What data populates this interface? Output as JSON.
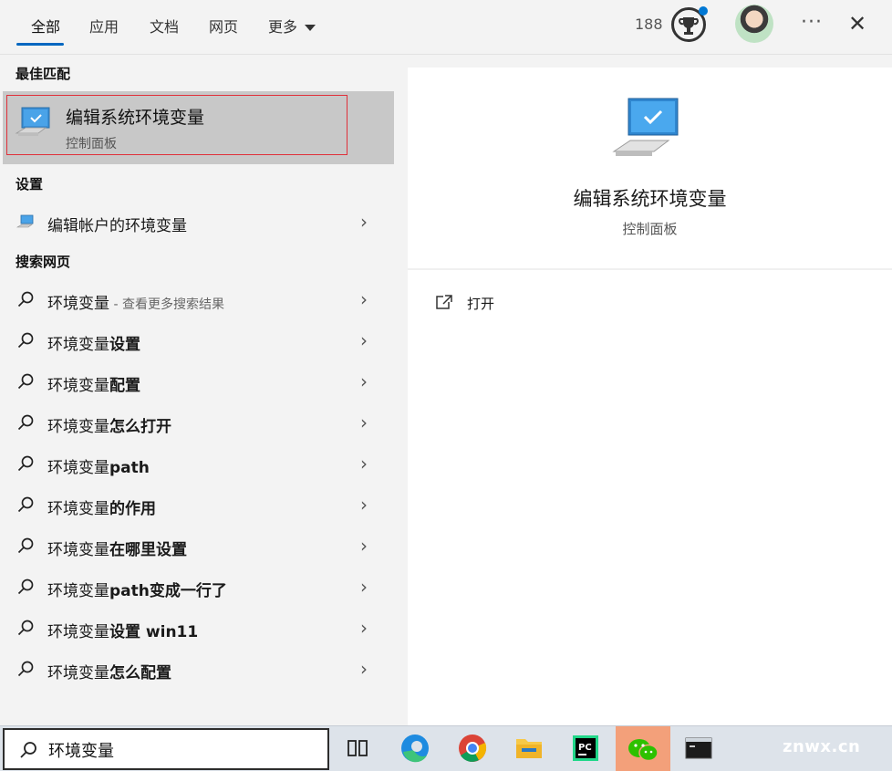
{
  "header": {
    "tabs": [
      {
        "label": "全部"
      },
      {
        "label": "应用"
      },
      {
        "label": "文档"
      },
      {
        "label": "网页"
      },
      {
        "label": "更多"
      }
    ],
    "points": "188",
    "more_label": "···",
    "close_label": "✕"
  },
  "left": {
    "best_match_title": "最佳匹配",
    "best_match": {
      "title": "编辑系统环境变量",
      "subtitle": "控制面板"
    },
    "settings_title": "设置",
    "settings_item": "编辑帐户的环境变量",
    "web_title": "搜索网页",
    "web_items": [
      {
        "normal": "环境变量",
        "bold": "",
        "hint": " - 查看更多搜索结果"
      },
      {
        "normal": "环境变量",
        "bold": "设置",
        "hint": ""
      },
      {
        "normal": "环境变量",
        "bold": "配置",
        "hint": ""
      },
      {
        "normal": "环境变量",
        "bold": "怎么打开",
        "hint": ""
      },
      {
        "normal": "环境变量",
        "bold": "path",
        "hint": ""
      },
      {
        "normal": "环境变量",
        "bold": "的作用",
        "hint": ""
      },
      {
        "normal": "环境变量",
        "bold": "在哪里设置",
        "hint": ""
      },
      {
        "normal": "环境变量",
        "bold": "path变成一行了",
        "hint": ""
      },
      {
        "normal": "环境变量",
        "bold": "设置 win11",
        "hint": ""
      },
      {
        "normal": "环境变量",
        "bold": "怎么配置",
        "hint": ""
      }
    ],
    "chevron": "›"
  },
  "right": {
    "title": "编辑系统环境变量",
    "subtitle": "控制面板",
    "action_open": "打开"
  },
  "taskbar": {
    "search_value": "环境变量",
    "watermark": "znwx.cn",
    "apps": [
      "task-view-icon",
      "edge-icon",
      "chrome-icon",
      "file-explorer-icon",
      "pycharm-icon",
      "wechat-icon",
      "terminal-icon"
    ]
  },
  "colors": {
    "accent": "#0067c0",
    "highlight": "#c8c8c8",
    "outline": "#e0303a"
  }
}
